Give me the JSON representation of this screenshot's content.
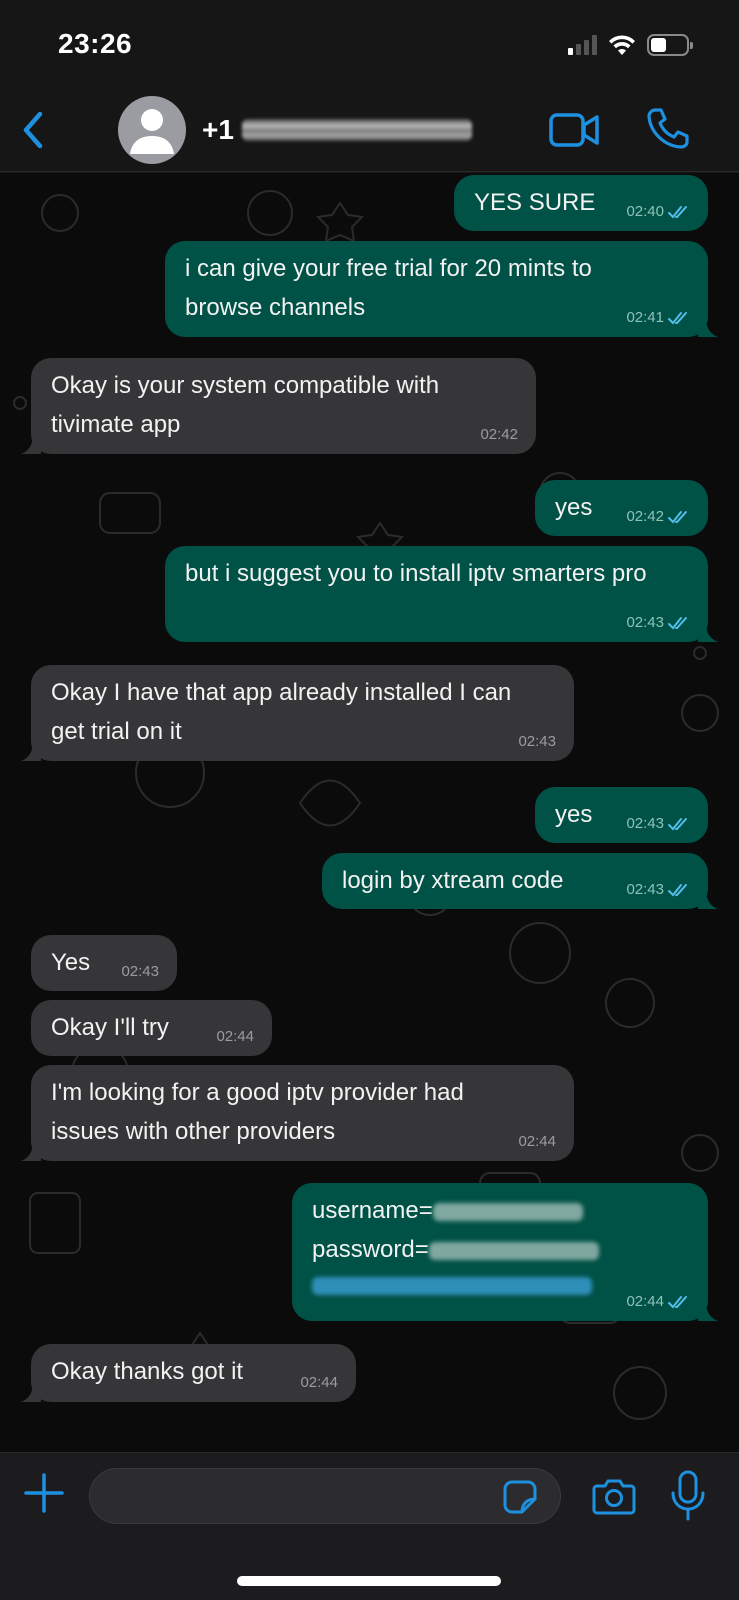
{
  "status_bar": {
    "time": "23:26",
    "signal_bars": 1,
    "battery_level_percent": 45
  },
  "header": {
    "back_icon": "chevron-left-icon",
    "contact_prefix": "+1",
    "contact_redacted": true,
    "actions": [
      {
        "name": "video-call",
        "icon": "video-camera-icon"
      },
      {
        "name": "voice-call",
        "icon": "phone-icon"
      }
    ]
  },
  "colors": {
    "accent": "#1e90e0",
    "outgoing_bubble": "#005246",
    "incoming_bubble": "#363638",
    "read_ticks": "#53bdeb",
    "background": "#0b0b0b"
  },
  "messages": [
    {
      "direction": "out",
      "text": "YES SURE",
      "time": "02:40",
      "status": "read"
    },
    {
      "direction": "out",
      "text": "i can give your free trial for 20 mints to browse channels",
      "time": "02:41",
      "status": "read"
    },
    {
      "direction": "in",
      "text": "Okay is your system compatible with tivimate app",
      "time": "02:42"
    },
    {
      "direction": "out",
      "text": "yes",
      "time": "02:42",
      "status": "read"
    },
    {
      "direction": "out",
      "text": "but i suggest you to install iptv smarters pro",
      "time": "02:43",
      "status": "read"
    },
    {
      "direction": "in",
      "text": "Okay I have that app already installed I can get trial on it",
      "time": "02:43"
    },
    {
      "direction": "out",
      "text": "yes",
      "time": "02:43",
      "status": "read"
    },
    {
      "direction": "out",
      "text": "login by xtream code",
      "time": "02:43",
      "status": "read"
    },
    {
      "direction": "in",
      "text": "Yes",
      "time": "02:43"
    },
    {
      "direction": "in",
      "text": "Okay I'll try",
      "time": "02:44"
    },
    {
      "direction": "in",
      "text": "I'm looking for a good iptv provider had issues with other providers",
      "time": "02:44"
    },
    {
      "direction": "out",
      "text_lines": [
        "username=",
        "password="
      ],
      "redacted_link": true,
      "time": "02:44",
      "status": "read"
    },
    {
      "direction": "in",
      "text": "Okay thanks got it",
      "time": "02:44"
    }
  ],
  "composer": {
    "placeholder": "",
    "value": "",
    "plus_icon": "plus-icon",
    "sticker_icon": "sticker-icon",
    "camera_icon": "camera-icon",
    "mic_icon": "microphone-icon"
  }
}
